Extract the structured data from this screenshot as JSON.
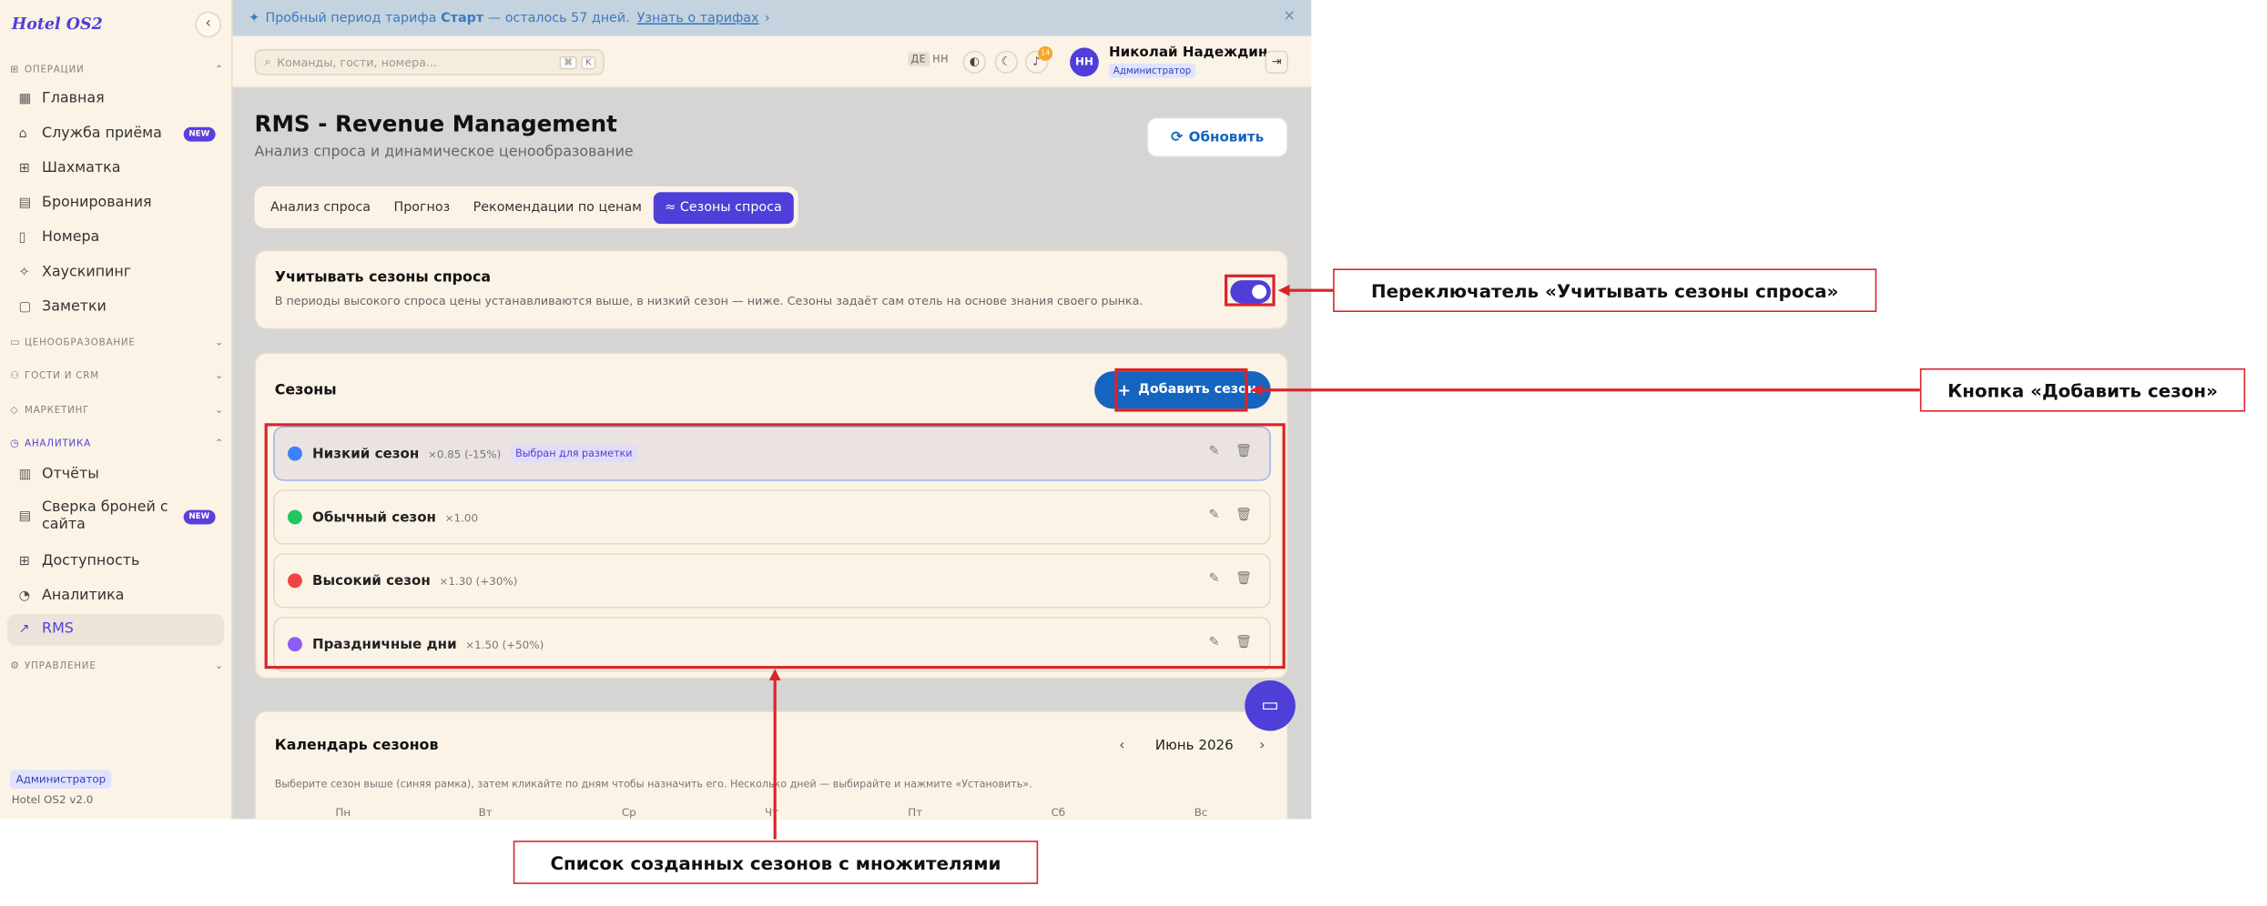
{
  "sidebar": {
    "logo": "Hotel OS2",
    "collapse_icon": "‹",
    "sections": [
      {
        "label": "ОПЕРАЦИИ",
        "chevron": "⌃"
      },
      {
        "label": "ЦЕНООБРАЗОВАНИЕ",
        "chevron": "⌄"
      },
      {
        "label": "ГОСТИ И CRM",
        "chevron": "⌄"
      },
      {
        "label": "МАРКЕТИНГ",
        "chevron": "⌄"
      },
      {
        "label": "АНАЛИТИКА",
        "chevron": "⌃"
      },
      {
        "label": "УПРАВЛЕНИЕ",
        "chevron": "⌄"
      }
    ],
    "items": [
      {
        "label": "Главная"
      },
      {
        "label": "Служба приёма",
        "badge": "NEW"
      },
      {
        "label": "Шахматка"
      },
      {
        "label": "Бронирования"
      },
      {
        "label": "Номера"
      },
      {
        "label": "Хаускипинг"
      },
      {
        "label": "Заметки"
      },
      {
        "label": "Отчёты"
      },
      {
        "label": "Сверка броней с сайта",
        "badge": "NEW"
      },
      {
        "label": "Доступность"
      },
      {
        "label": "Аналитика"
      },
      {
        "label": "RMS"
      }
    ],
    "role": "Администратор",
    "version": "Hotel OS2 v2.0"
  },
  "trial_banner": {
    "prefix": "Пробный период тарифа",
    "plan": "Старт",
    "suffix": "— осталось 57 дней.",
    "link": "Узнать о тарифах",
    "link_arrow": "›",
    "close": "×"
  },
  "header": {
    "search_placeholder": "Команды, гости, номера...",
    "kbd1": "⌘",
    "kbd2": "K",
    "lang_active": "ДЕ",
    "lang_other": "НН",
    "notif_count": "14",
    "avatar_initials": "НН",
    "user_name": "Николай Надеждин",
    "user_role": "Администратор"
  },
  "page": {
    "title": "RMS - Revenue Management",
    "subtitle": "Анализ спроса и динамическое ценообразование",
    "refresh": "Обновить",
    "tabs": [
      "Анализ спроса",
      "Прогноз",
      "Рекомендации по ценам",
      "Сезоны спроса"
    ]
  },
  "seasons_toggle": {
    "title": "Учитывать сезоны спроса",
    "description": "В периоды высокого спроса цены устанавливаются выше, в низкий сезон — ниже. Сезоны задаёт сам отель на основе знания своего рынка.",
    "enabled": true
  },
  "seasons": {
    "title": "Сезоны",
    "add_button": "Добавить сезон",
    "items": [
      {
        "name": "Низкий сезон",
        "multiplier": "×0.85 (-15%)",
        "badge": "Выбран для разметки",
        "color": "#3b82f6"
      },
      {
        "name": "Обычный сезон",
        "multiplier": "×1.00",
        "color": "#22c55e"
      },
      {
        "name": "Высокий сезон",
        "multiplier": "×1.30 (+30%)",
        "color": "#ef4444"
      },
      {
        "name": "Праздничные дни",
        "multiplier": "×1.50 (+50%)",
        "color": "#8b5cf6"
      }
    ]
  },
  "calendar": {
    "title": "Календарь сезонов",
    "prev": "‹",
    "month": "Июнь 2026",
    "next": "›",
    "hint": "Выберите сезон выше (синяя рамка), затем кликайте по дням чтобы назначить его. Несколько дней — выбирайте и нажмите «Установить».",
    "weekdays": [
      "Пн",
      "Вт",
      "Ср",
      "Чт",
      "Пт",
      "Сб",
      "Вс"
    ]
  },
  "annotations": {
    "toggle": "Переключатель «Учитывать сезоны спроса»",
    "add": "Кнопка «Добавить сезон»",
    "list": "Список созданных сезонов с множителями"
  },
  "colors": {
    "accent": "#4f3fd8",
    "primary_button": "#1565c0",
    "annotation": "#d9242a"
  }
}
